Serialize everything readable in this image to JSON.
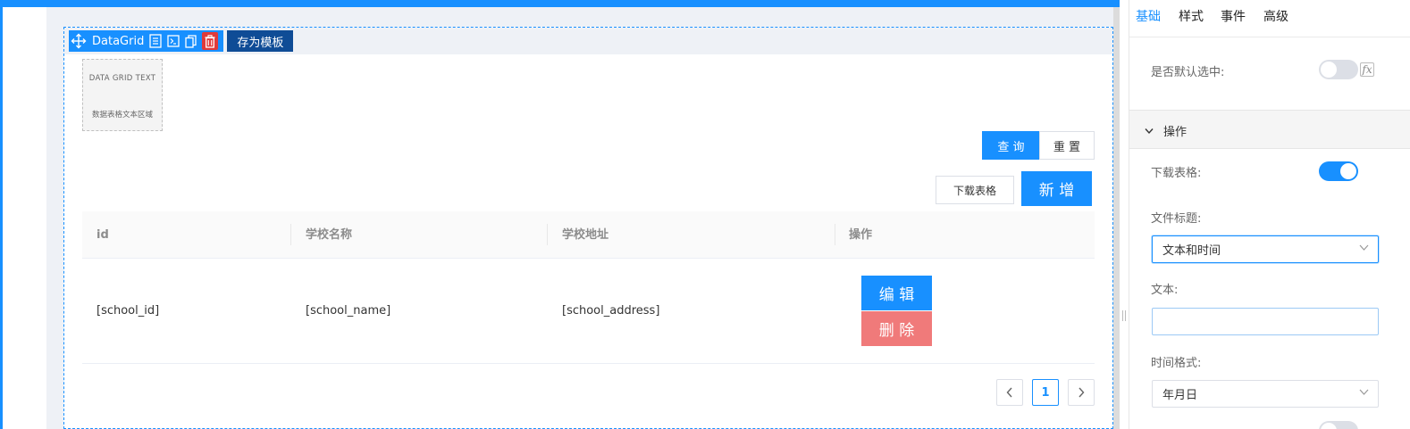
{
  "toolbar": {
    "component_name": "DataGrid",
    "save_template_label": "存为模板"
  },
  "placeholder": {
    "line1": "DATA GRID TEXT",
    "line2": "数据表格文本区域"
  },
  "actions": {
    "query_label": "查 询",
    "reset_label": "重 置",
    "download_label": "下载表格",
    "add_label": "新 增"
  },
  "table": {
    "columns": [
      "id",
      "学校名称",
      "学校地址",
      "操作"
    ],
    "rows": [
      {
        "id": "[school_id]",
        "name": "[school_name]",
        "address": "[school_address]",
        "edit_label": "编 辑",
        "delete_label": "删 除"
      }
    ]
  },
  "pagination": {
    "current": "1"
  },
  "panel": {
    "tabs": [
      "基础",
      "样式",
      "事件",
      "高级"
    ],
    "default_selected_label": "是否默认选中:",
    "fx_label": "fx",
    "section_operation": "操作",
    "download_table_label": "下载表格:",
    "file_title_label": "文件标题:",
    "file_title_value": "文本和时间",
    "text_label": "文本:",
    "text_value": "",
    "time_format_label": "时间格式:",
    "time_format_value": "年月日"
  },
  "colors": {
    "primary": "#1890ff",
    "danger": "#f07a7a",
    "save_bg": "#0f4c96"
  }
}
